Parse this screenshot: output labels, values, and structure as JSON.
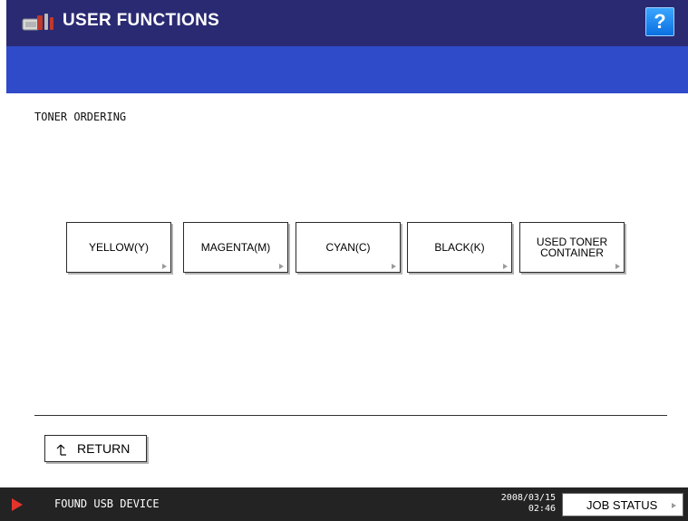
{
  "header": {
    "title": "USER FUNCTIONS",
    "help_label": "?",
    "app_icon": "user-functions-icon"
  },
  "page": {
    "title": "TONER ORDERING"
  },
  "buttons": {
    "yellow": "YELLOW(Y)",
    "magenta": "MAGENTA(M)",
    "cyan": "CYAN(C)",
    "black": "BLACK(K)",
    "used_toner_line1": "USED TONER",
    "used_toner_line2": "CONTAINER"
  },
  "return_label": "RETURN",
  "status_bar": {
    "message": "FOUND USB DEVICE",
    "date": "2008/03/15",
    "time": "02:46",
    "job_status_label": "JOB STATUS"
  },
  "colors": {
    "header": "#2a2a73",
    "subbar": "#2f4bc9",
    "help_button": "#1a8af0",
    "status_bar": "#232323",
    "status_arrow": "#e6342c"
  }
}
